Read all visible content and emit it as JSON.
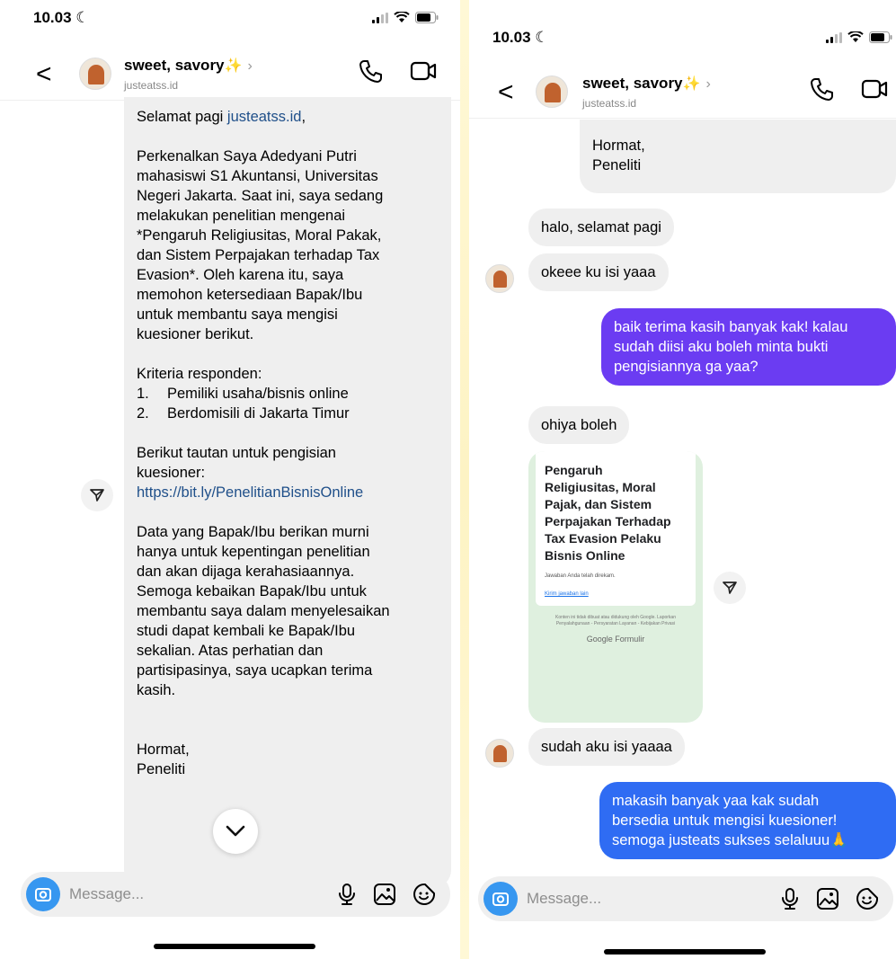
{
  "left": {
    "status": {
      "time": "10.03"
    },
    "header": {
      "name": "sweet, savory",
      "sparkle": "✨",
      "chevron": "›",
      "username": "justeatss.id"
    },
    "message": {
      "greeting_prefix": "Selamat pagi ",
      "greeting_link": "justeatss.id",
      "greeting_suffix": ",",
      "intro_lines": [
        "Perkenalkan Saya Adedyani Putri",
        "mahasiswi S1 Akuntansi, Universitas",
        "Negeri Jakarta. Saat ini, saya sedang",
        "melakukan penelitian mengenai",
        "*Pengaruh Religiusitas, Moral Pakak,",
        "dan Sistem Perpajakan terhadap Tax",
        "Evasion*. Oleh karena itu, saya",
        "memohon ketersediaan Bapak/Ibu",
        "untuk membantu saya mengisi",
        "kuesioner berikut."
      ],
      "criteria_title": "Kriteria responden:",
      "criteria": [
        {
          "num": "1.",
          "text": "Pemiliki usaha/bisnis online"
        },
        {
          "num": "2.",
          "text": "Berdomisili di Jakarta Timur"
        }
      ],
      "link_intro_lines": [
        "Berikut tautan untuk pengisian",
        "kuesioner:"
      ],
      "url": "https://bit.ly/PenelitianBisnisOnline",
      "closing_lines": [
        "Data yang Bapak/Ibu berikan murni",
        "hanya untuk kepentingan penelitian",
        "dan akan dijaga kerahasiaannya.",
        "Semoga kebaikan Bapak/Ibu untuk",
        "membantu saya dalam menyelesaikan",
        "studi dapat kembali ke Bapak/Ibu",
        "sekalian. Atas perhatian dan",
        "partisipasinya, saya ucapkan terima",
        "kasih."
      ],
      "sign_1": "Hormat,",
      "sign_2": "Peneliti"
    },
    "input": {
      "placeholder": "Message..."
    }
  },
  "right": {
    "status": {
      "time": "10.03"
    },
    "header": {
      "name": "sweet, savory",
      "sparkle": "✨",
      "chevron": "›",
      "username": "justeatss.id"
    },
    "messages": {
      "m0_line1": "Hormat,",
      "m0_line2": "Peneliti",
      "m1": "halo, selamat pagi",
      "m2": "okeee ku isi yaaa",
      "m3_lines": [
        "baik terima kasih banyak kak! kalau",
        "sudah diisi aku boleh minta bukti",
        "pengisiannya ga yaa?"
      ],
      "m4": "ohiya boleh",
      "form": {
        "title_lines": [
          "Pengaruh",
          "Religiusitas, Moral",
          "Pajak, dan Sistem",
          "Perpajakan Terhadap",
          "Tax Evasion Pelaku",
          "Bisnis Online"
        ],
        "subtitle": "Jawaban Anda telah direkam.",
        "link": "Kirim jawaban lain",
        "footer_1": "Konten ini tidak dibuat atau didukung oleh Google. Laporkan",
        "footer_2": "Penyalahgunaan - Persyaratan Layanan - Kebijakan Privasi",
        "brand": "Google Formulir"
      },
      "m5": "sudah aku isi yaaaa",
      "m6_lines": [
        "makasih banyak yaa kak sudah",
        "bersedia untuk mengisi kuesioner!",
        "semoga justeats sukses selaluuu🙏"
      ]
    },
    "input": {
      "placeholder": "Message..."
    }
  },
  "colors": {
    "sent_purple": "#6b3cf2",
    "sent_blue": "#2f6cf3",
    "received_gray": "#efefef",
    "camera_blue": "#3797f0",
    "form_green": "#dff0df"
  }
}
